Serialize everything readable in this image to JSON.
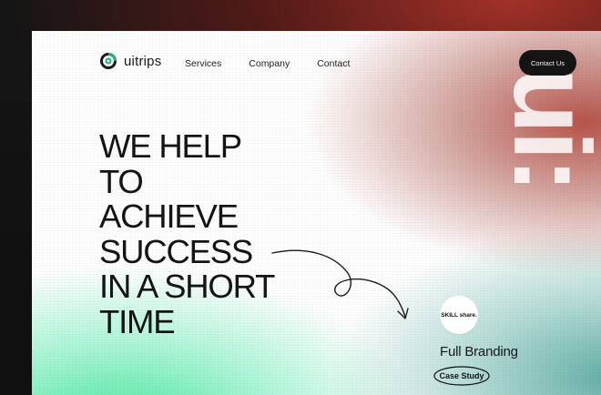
{
  "brand": {
    "name": "uitrips",
    "logo_icon": "ring-logo-icon",
    "accent": "#1fb07a"
  },
  "nav": {
    "links": [
      "Services",
      "Company",
      "Contact"
    ],
    "cta_label": "Contact Us"
  },
  "hero": {
    "lines": [
      "WE HELP",
      "TO",
      "ACHIEVE",
      "SUCCESS",
      "IN A SHORT",
      "TIME"
    ]
  },
  "feature": {
    "partner_logo_text": "SKILL share.",
    "title": "Full Branding",
    "link_label": "Case Study"
  },
  "colors": {
    "red": "#b0463c",
    "green": "#3ce696",
    "teal": "#5aaaa0",
    "button": "#141414"
  }
}
